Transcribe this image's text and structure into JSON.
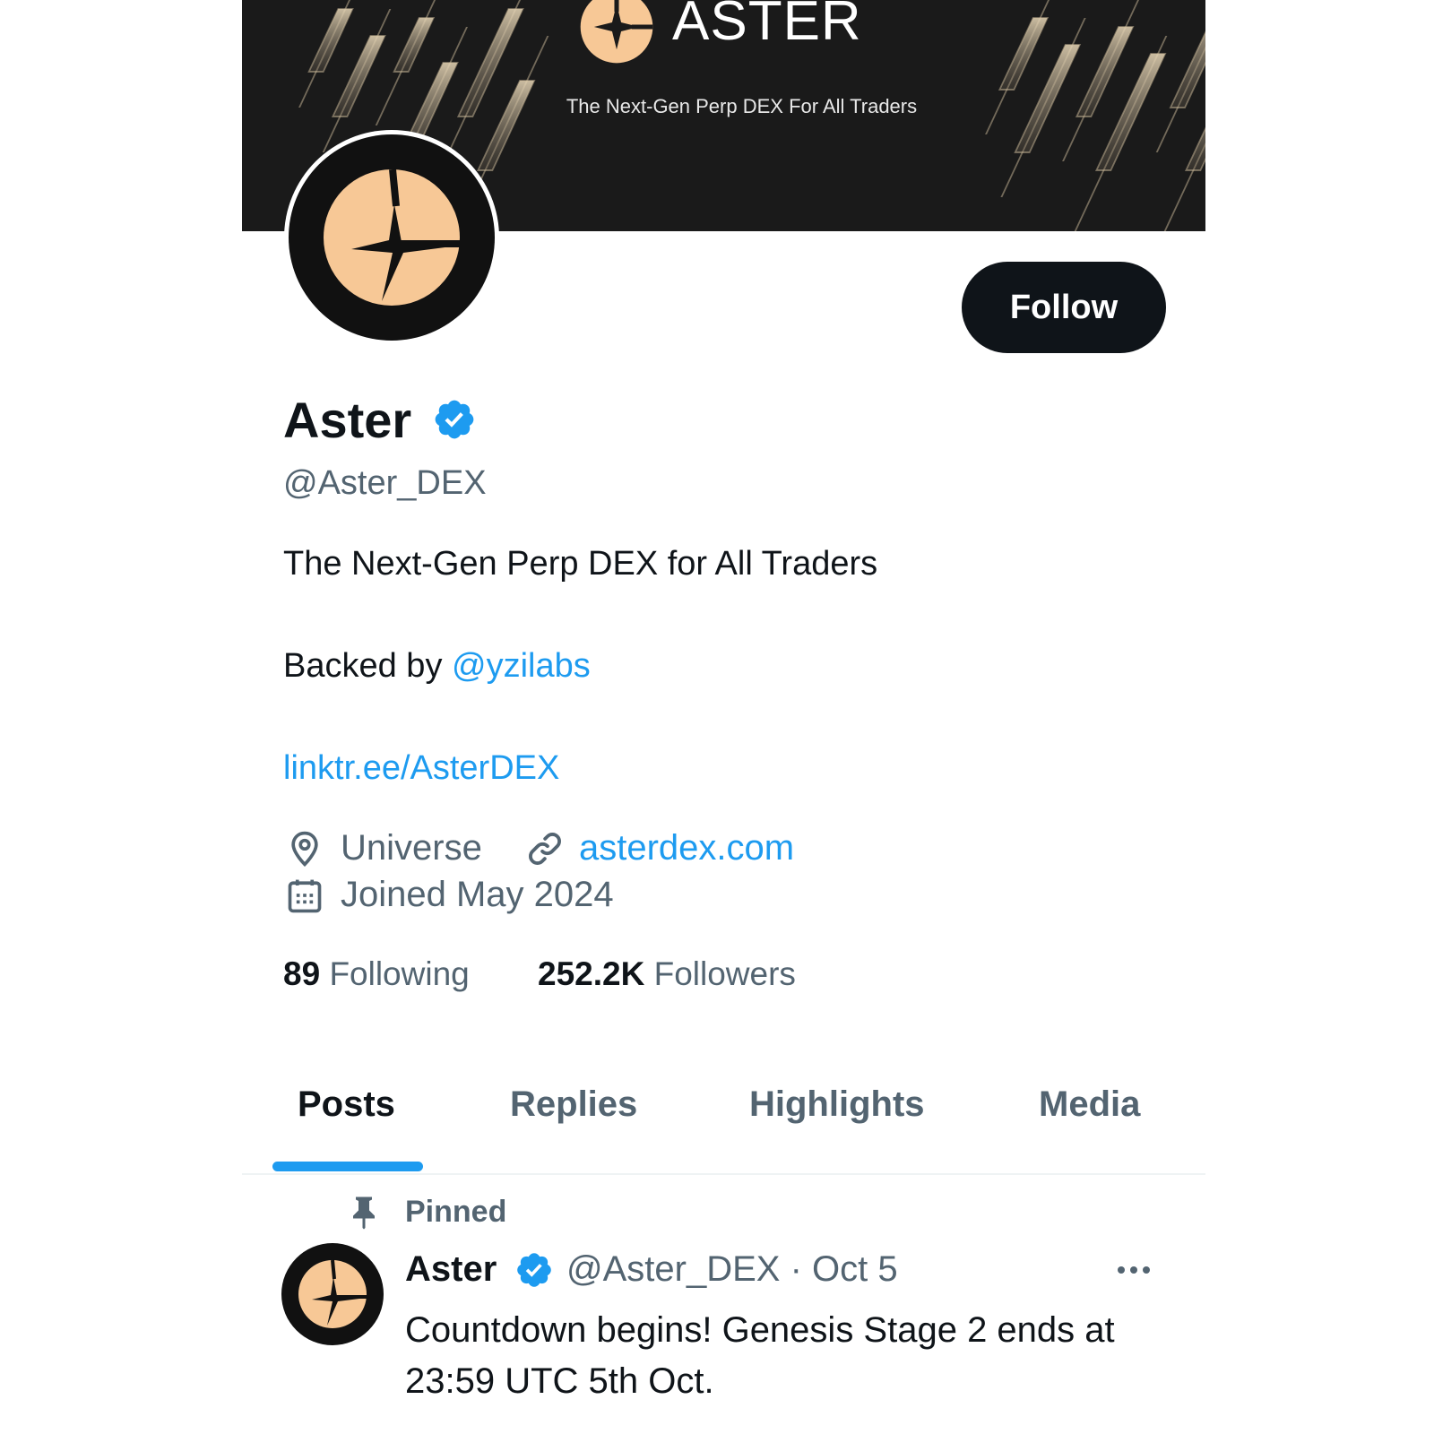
{
  "banner": {
    "title": "ASTER",
    "tagline": "The Next-Gen Perp DEX For All Traders"
  },
  "profile": {
    "name": "Aster",
    "handle": "@Aster_DEX",
    "bio_line1": "The Next-Gen Perp DEX for All Traders",
    "bio_backed_prefix": "Backed by ",
    "bio_backed_mention": "@yzilabs",
    "bio_link": "linktr.ee/AsterDEX",
    "location": "Universe",
    "website": "asterdex.com",
    "joined": "Joined May 2024",
    "following_count": "89",
    "following_label": "Following",
    "followers_count": "252.2K",
    "followers_label": "Followers",
    "follow_button": "Follow"
  },
  "tabs": [
    {
      "label": "Posts",
      "active": true
    },
    {
      "label": "Replies",
      "active": false
    },
    {
      "label": "Highlights",
      "active": false
    },
    {
      "label": "Media",
      "active": false
    }
  ],
  "pinned_post": {
    "pinned_label": "Pinned",
    "author": "Aster",
    "meta": "@Aster_DEX · Oct 5",
    "text": "Countdown begins! Genesis Stage 2 ends at 23:59 UTC 5th Oct."
  },
  "colors": {
    "accent": "#1d9bf0",
    "text_primary": "#0f1419",
    "text_secondary": "#536471",
    "logo_peach": "#f7c896",
    "banner_bg": "#1a1a1a"
  },
  "icons": {
    "verified": "verified-badge-icon",
    "location": "location-pin-icon",
    "link": "link-icon",
    "calendar": "calendar-icon",
    "pin": "pin-icon",
    "more": "more-dots-icon"
  }
}
